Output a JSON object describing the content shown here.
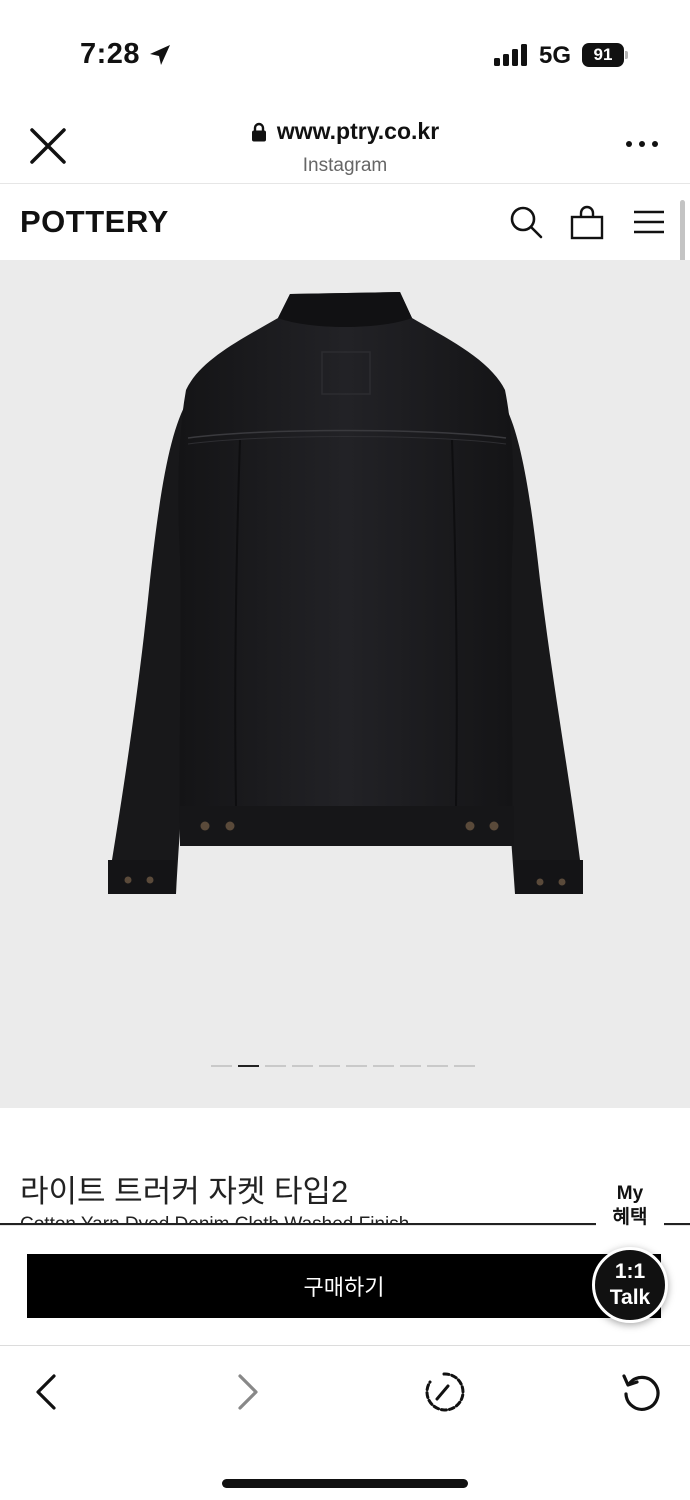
{
  "status_bar": {
    "time": "7:28",
    "network": "5G",
    "battery": "91"
  },
  "browser": {
    "url": "www.ptry.co.kr",
    "source": "Instagram"
  },
  "site": {
    "logo": "POTTERY"
  },
  "gallery": {
    "total_images": 10,
    "active_index": 2,
    "background_color": "#ebebeb"
  },
  "product": {
    "title": "라이트 트러커 자켓 타입2",
    "subtitle": "Cotton Yarn Dyed Denim Cloth Washed Finish",
    "buy_label": "구매하기"
  },
  "floating": {
    "my_benefit_line1": "My",
    "my_benefit_line2": "혜택",
    "talk_line1": "1:1",
    "talk_line2": "Talk"
  },
  "colors": {
    "buy_button": "#000000",
    "jacket": "#1c1c1e"
  },
  "icons": {
    "header": [
      "search-icon",
      "shopping-bag-icon",
      "menu-icon"
    ],
    "toolbar": [
      "back-icon",
      "forward-icon",
      "speed-icon",
      "reload-icon"
    ]
  }
}
